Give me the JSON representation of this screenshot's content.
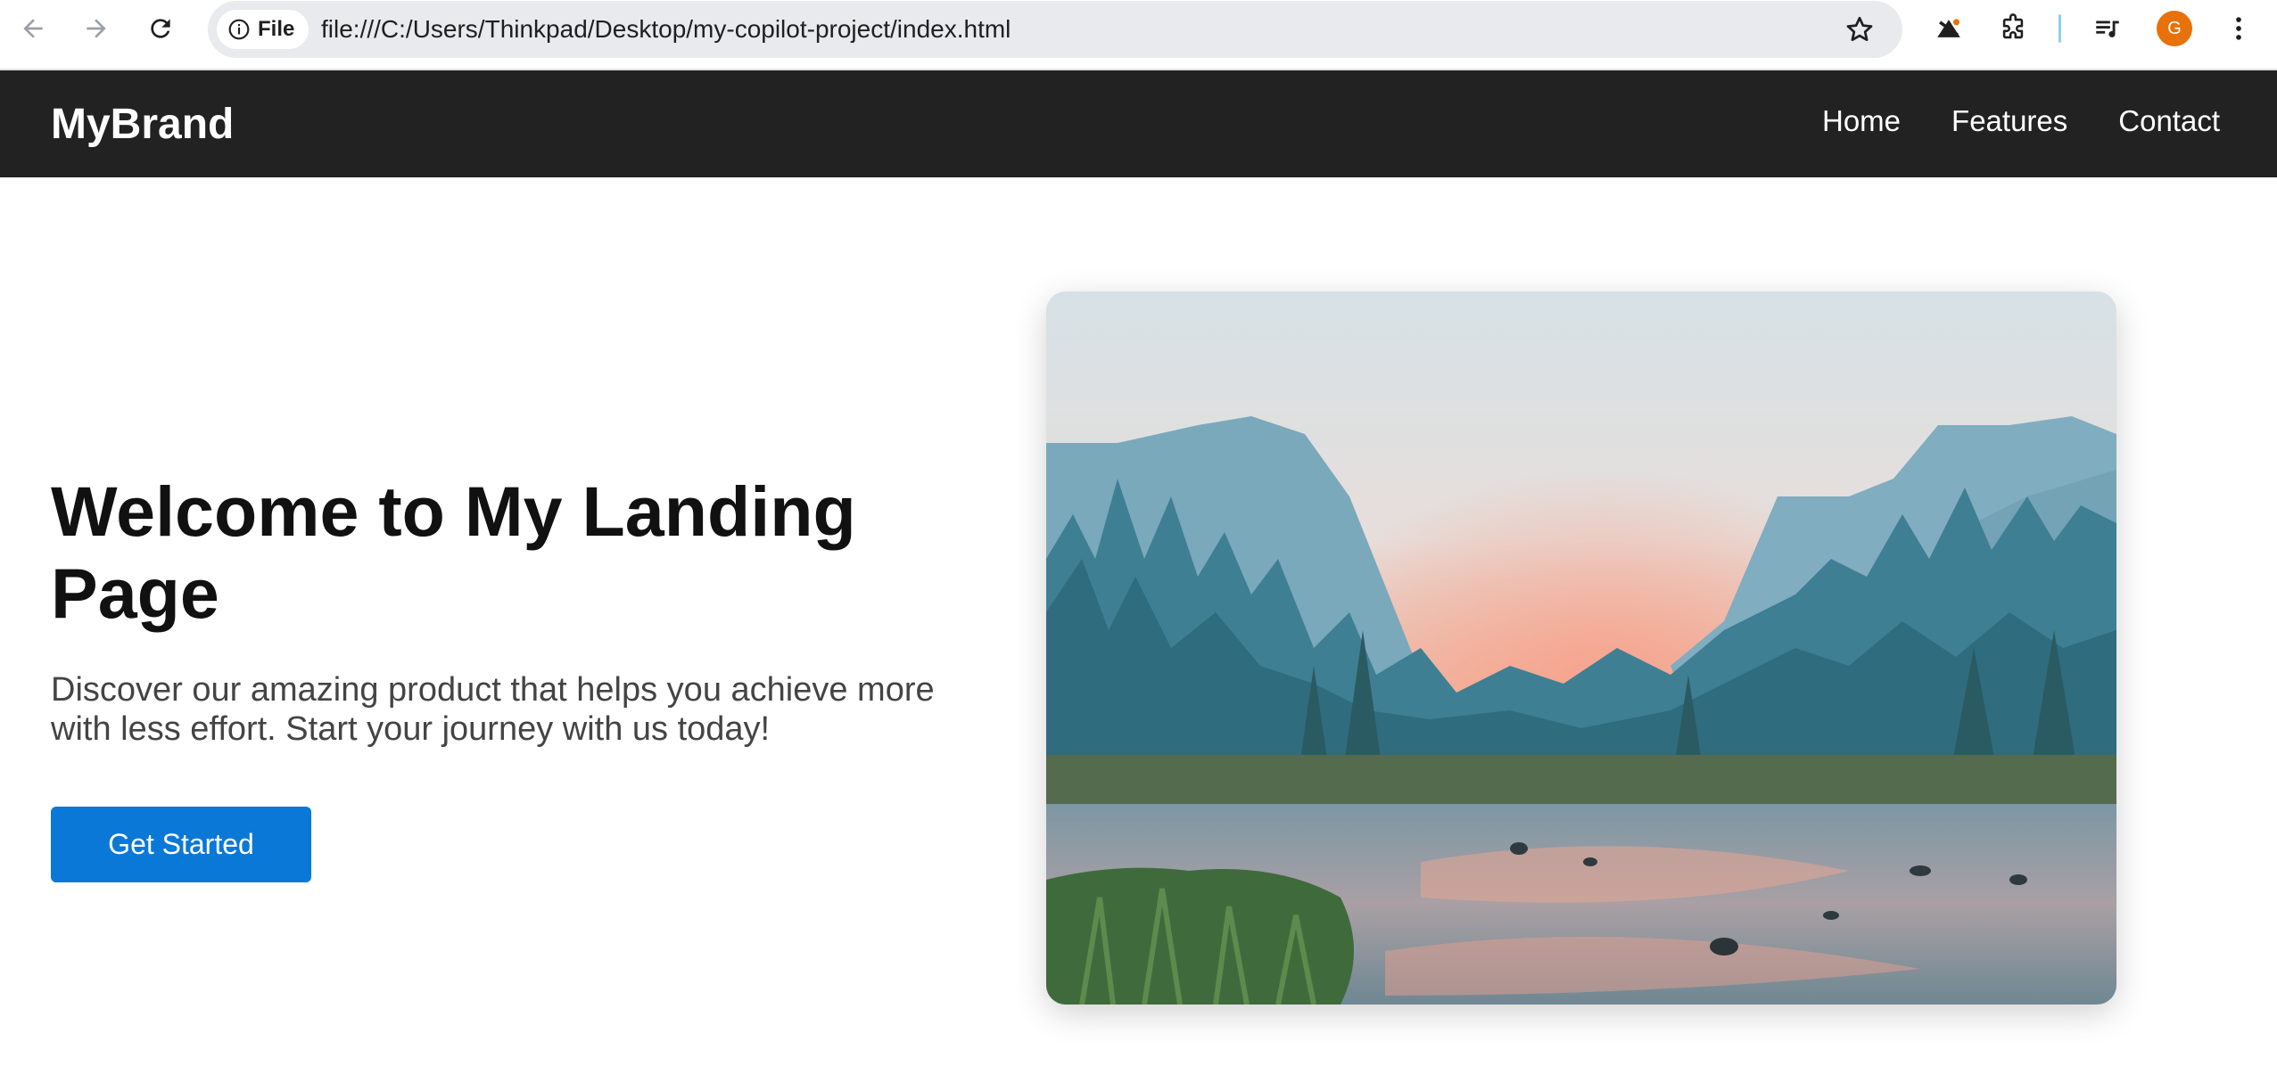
{
  "browser": {
    "site_chip_label": "File",
    "url": "file:///C:/Users/Thinkpad/Desktop/my-copilot-project/index.html",
    "profile_initial": "G",
    "icons": [
      "back-arrow-icon",
      "forward-arrow-icon",
      "reload-icon",
      "info-icon",
      "star-icon",
      "extension-puzzle-icon",
      "media-queue-icon",
      "more-vert-icon"
    ]
  },
  "header": {
    "brand": "MyBrand",
    "nav": [
      "Home",
      "Features",
      "Contact"
    ]
  },
  "hero": {
    "title": "Welcome to My Landing Page",
    "description": "Discover our amazing product that helps you achieve more with less effort. Start your journey with us today!",
    "cta_label": "Get Started"
  },
  "colors": {
    "header_bg": "#222222",
    "cta_bg": "#0a78d7",
    "avatar_bg": "#e8710a"
  }
}
